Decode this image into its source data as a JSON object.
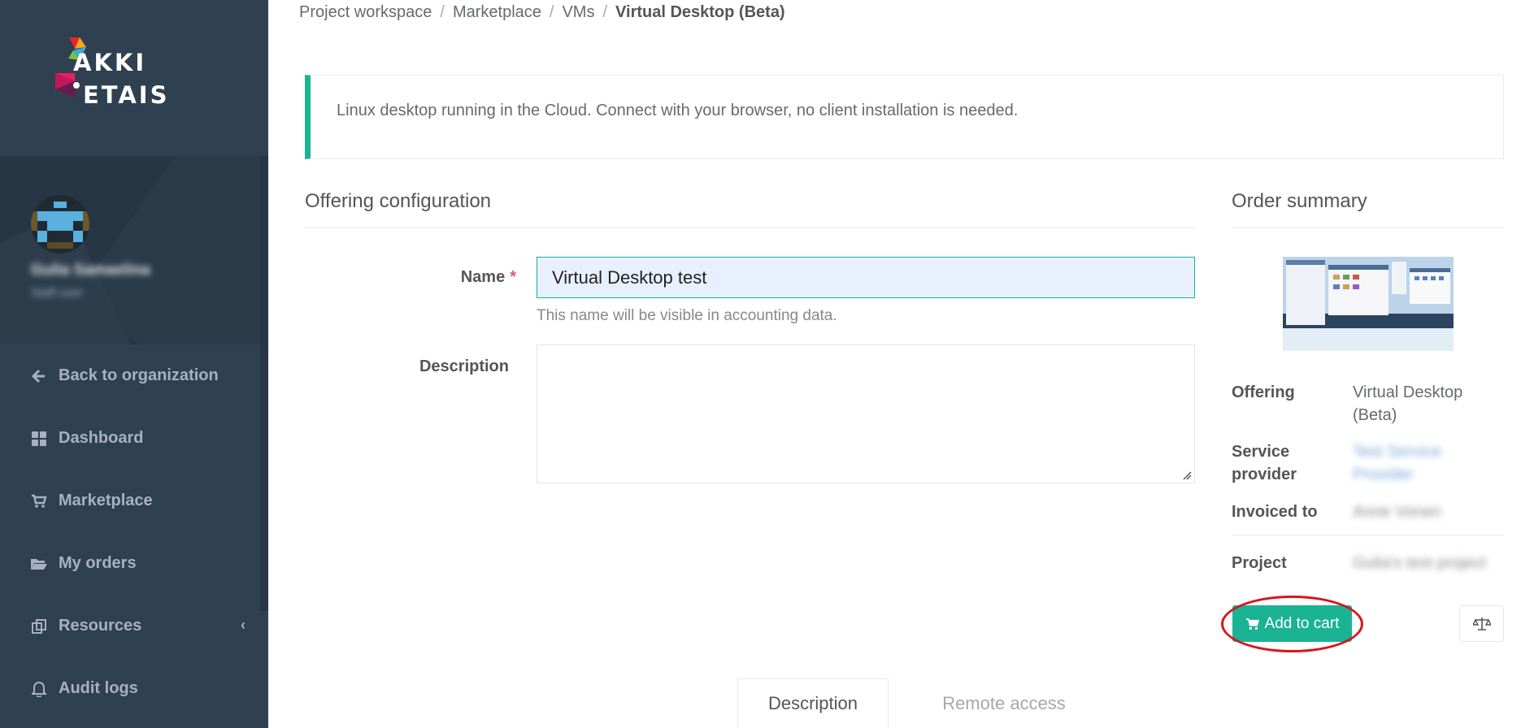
{
  "logo": {
    "line1": "AKKI",
    "line2": "ETAIS"
  },
  "profile": {
    "name": "Gulia Samaelina",
    "role": "Staff user"
  },
  "nav": [
    {
      "label": "Back to organization",
      "icon": "arrow-left-icon"
    },
    {
      "label": "Dashboard",
      "icon": "dashboard-icon"
    },
    {
      "label": "Marketplace",
      "icon": "cart-icon"
    },
    {
      "label": "My orders",
      "icon": "folder-open-icon"
    },
    {
      "label": "Resources",
      "icon": "resources-icon",
      "chevron": "‹"
    },
    {
      "label": "Audit logs",
      "icon": "bell-icon"
    }
  ],
  "breadcrumb": {
    "items": [
      "Project workspace",
      "Marketplace",
      "VMs"
    ],
    "separator": "/",
    "current": "Virtual Desktop (Beta)"
  },
  "callout": {
    "text": "Linux desktop running in the Cloud. Connect with your browser, no client installation is needed."
  },
  "config": {
    "title": "Offering configuration",
    "name_label": "Name",
    "required_mark": "*",
    "name_value": "Virtual Desktop test",
    "name_help": "This name will be visible in accounting data.",
    "description_label": "Description",
    "description_value": ""
  },
  "summary": {
    "title": "Order summary",
    "offering_label": "Offering",
    "offering_value": "Virtual Desktop (Beta)",
    "provider_label": "Service provider",
    "provider_value": "Test Service Provider",
    "invoiced_label": "Invoiced to",
    "invoiced_value": "Anne Vonen",
    "project_label": "Project",
    "project_value": "Gulia's test project",
    "add_to_cart": "Add to cart"
  },
  "tabs": [
    {
      "label": "Description",
      "active": true
    },
    {
      "label": "Remote access",
      "active": false
    }
  ],
  "colors": {
    "sidebar": "#2f4050",
    "accent": "#1ab394",
    "highlight_ring": "#d6161c"
  }
}
